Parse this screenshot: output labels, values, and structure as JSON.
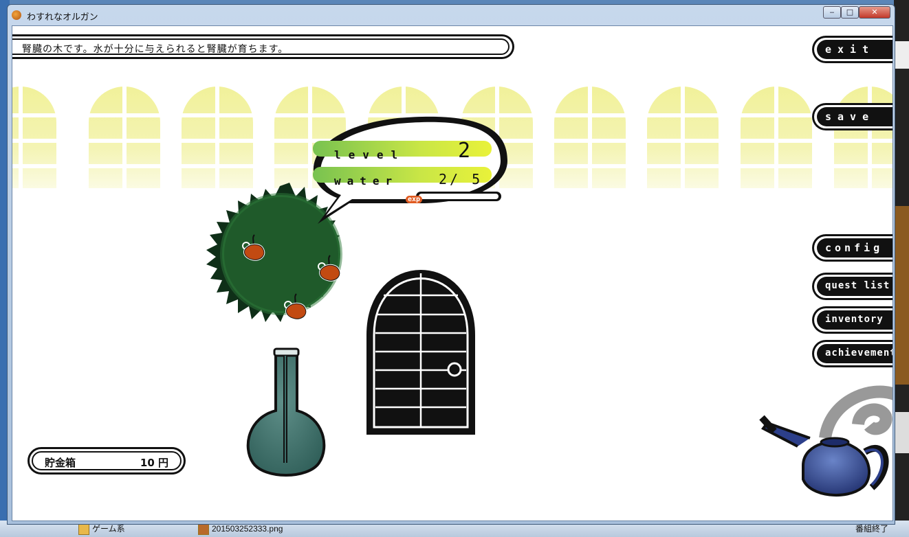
{
  "window": {
    "title": "わすれなオルガン",
    "controls": {
      "minimize": "‒",
      "maximize": "□",
      "close": "✕"
    }
  },
  "message": "腎臓の木です。水が十分に与えられると腎臓が育ちます。",
  "status": {
    "level_label": "level",
    "level_value": "2",
    "water_label": "water",
    "water_value": "2/ 5",
    "exp_label": "exp",
    "exp_progress": 0.0
  },
  "menu": {
    "exit": "exit",
    "save": "save",
    "config": "config",
    "quest_list": "quest list",
    "inventory": "inventory",
    "achievement": "achievement"
  },
  "bank": {
    "label": "貯金箱",
    "value": "10 円"
  },
  "taskbar": {
    "item1": "ゲーム系",
    "item2": "201503252333.png",
    "item3": "番組終了"
  },
  "colors": {
    "tree_green": "#1f5a2a",
    "vase_teal": "#3d6f6a",
    "window_yellow": "#f3f3a8",
    "can_blue": "#2c3f8a",
    "bar_green": "#7fc34a",
    "bar_yellow": "#e6ef3a"
  }
}
